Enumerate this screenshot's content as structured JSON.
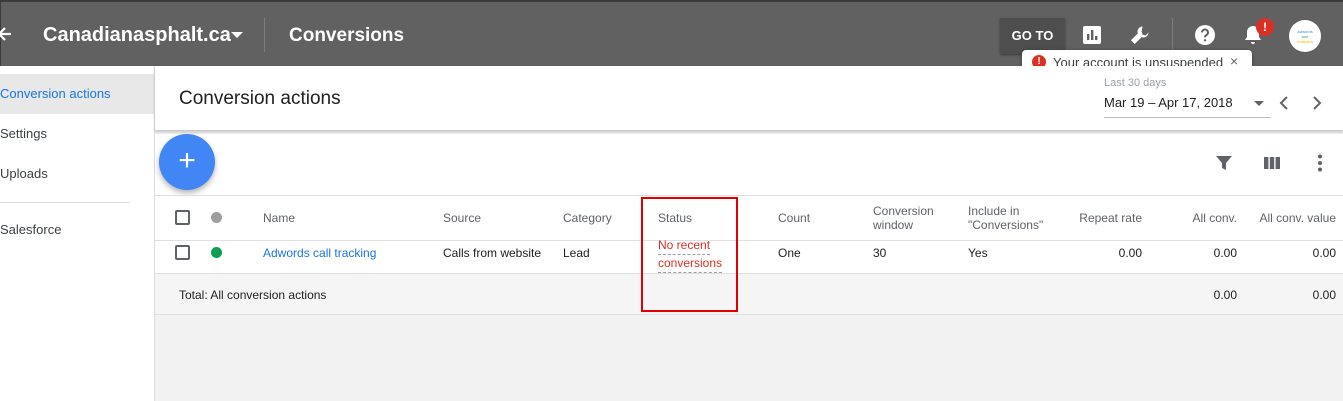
{
  "topbar": {
    "account_name": "Canadianasphalt.ca",
    "page_title": "Conversions",
    "goto_label": "GO TO",
    "notification_badge": "!",
    "avatar_text": [
      "Adwords",
      "and",
      "Analytics"
    ]
  },
  "toast": {
    "icon": "!",
    "message": "Your account is unsuspended",
    "close": "×"
  },
  "sidebar": {
    "items": [
      {
        "label": "Conversion actions",
        "active": true
      },
      {
        "label": "Settings",
        "active": false
      },
      {
        "label": "Uploads",
        "active": false
      },
      {
        "label": "Salesforce",
        "active": false
      }
    ]
  },
  "header": {
    "title": "Conversion actions",
    "range_label": "Last 30 days",
    "range_value": "Mar 19 – Apr 17, 2018"
  },
  "fab": {
    "label": "+"
  },
  "table": {
    "columns": {
      "name": "Name",
      "source": "Source",
      "category": "Category",
      "status": "Status",
      "count": "Count",
      "conversion_window": [
        "Conversion",
        "window"
      ],
      "include": [
        "Include in",
        "\"Conversions\""
      ],
      "repeat_rate": "Repeat rate",
      "all_conv": "All conv.",
      "all_conv_value": "All conv. value"
    },
    "rows": [
      {
        "name": "Adwords call tracking",
        "source": "Calls from website",
        "category": "Lead",
        "status": [
          "No recent",
          "conversions"
        ],
        "count": "One",
        "conversion_window": "30",
        "include": "Yes",
        "repeat_rate": "0.00",
        "all_conv": "0.00",
        "all_conv_value": "0.00"
      }
    ],
    "totals": {
      "label": "Total: All conversion actions",
      "all_conv": "0.00",
      "all_conv_value": "0.00"
    }
  },
  "colors": {
    "topbar": "#616161",
    "accent": "#1a73e8",
    "fab": "#4285f4",
    "status_error": "#d93025",
    "enabled_dot": "#0f9d58",
    "highlight_box": "#e00000"
  }
}
